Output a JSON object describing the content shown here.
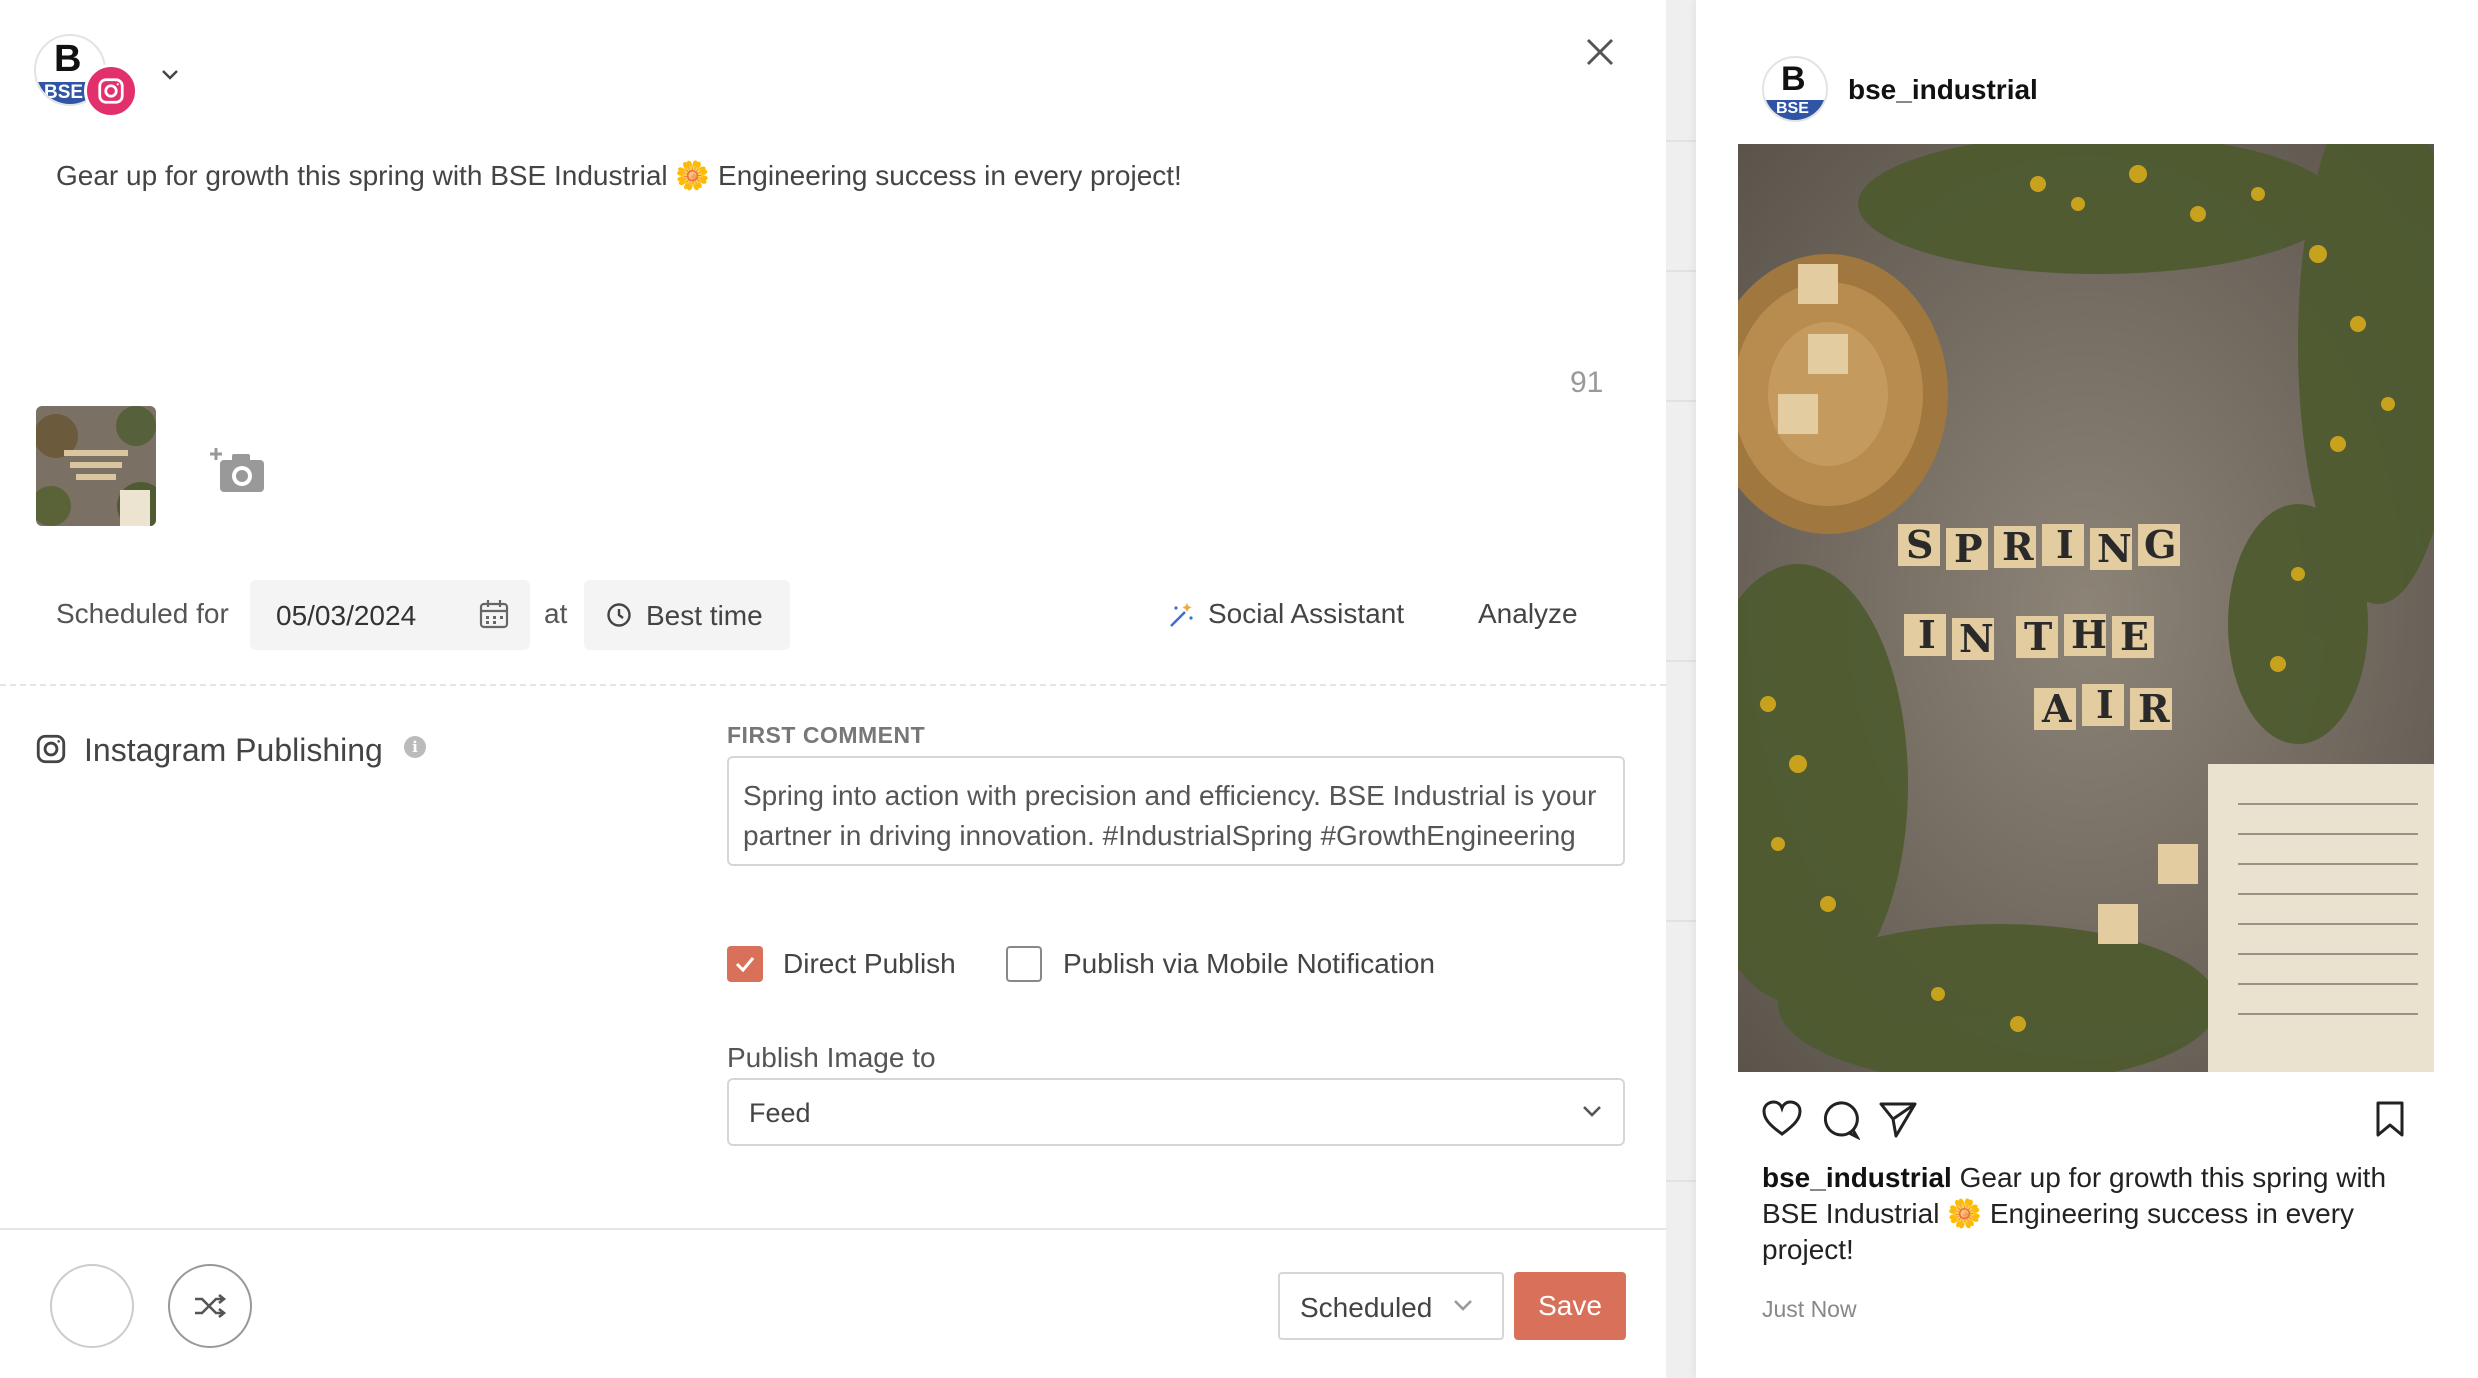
{
  "account": {
    "logo_letter": "B",
    "logo_text": "BSE",
    "network": "instagram"
  },
  "post": {
    "text": "Gear up for growth this spring with BSE Industrial 🌼 Engineering success in every project!",
    "char_count": "91"
  },
  "schedule": {
    "label": "Scheduled for",
    "date": "05/03/2024",
    "at_label": "at",
    "time": "Best time",
    "assistant_label": "Social Assistant",
    "analyze_label": "Analyze"
  },
  "instagram": {
    "section_title": "Instagram Publishing",
    "first_comment_label": "FIRST COMMENT",
    "first_comment": "Spring into action with precision and efficiency. BSE Industrial is your partner in driving innovation. #IndustrialSpring #GrowthEngineering",
    "direct_publish_label": "Direct Publish",
    "direct_publish_checked": true,
    "mobile_label": "Publish via Mobile Notification",
    "mobile_checked": false,
    "publish_to_label": "Publish Image to",
    "publish_to_value": "Feed"
  },
  "footer": {
    "status": "Scheduled",
    "save_label": "Save"
  },
  "preview": {
    "username": "bse_industrial",
    "caption": "Gear up for growth this spring with BSE Industrial 🌼 Engineering success in every project!",
    "time": "Just Now",
    "image_text": [
      "SPRING",
      "IN THE",
      "AIR"
    ]
  },
  "colors": {
    "accent": "#d9705a",
    "instagram": "#e1306c",
    "brand_blue": "#2f55a4"
  }
}
